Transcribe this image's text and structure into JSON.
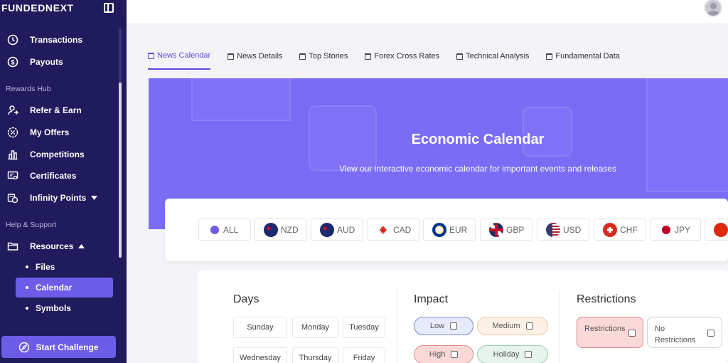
{
  "brand": {
    "logo": "FUNDEDNEXT"
  },
  "sidebar": {
    "items": [
      {
        "label": "Transactions",
        "icon": "clock-icon"
      },
      {
        "label": "Payouts",
        "icon": "dollar-icon"
      }
    ],
    "rewards_label": "Rewards Hub",
    "rewards_items": [
      {
        "label": "Refer & Earn",
        "icon": "user-share-icon"
      },
      {
        "label": "My Offers",
        "icon": "percent-badge-icon"
      },
      {
        "label": "Competitions",
        "icon": "bar-chart-icon"
      },
      {
        "label": "Certificates",
        "icon": "certificate-icon"
      },
      {
        "label": "Infinity Points",
        "icon": "coins-icon"
      }
    ],
    "help_label": "Help & Support",
    "resources_label": "Resources",
    "resources_sub": [
      {
        "label": "Files"
      },
      {
        "label": "Calendar",
        "active": true
      },
      {
        "label": "Symbols"
      }
    ],
    "start_button": "Start Challenge"
  },
  "tabs": [
    {
      "label": "News Calendar",
      "active": true
    },
    {
      "label": "News Details"
    },
    {
      "label": "Top Stories"
    },
    {
      "label": "Forex Cross Rates"
    },
    {
      "label": "Technical Analysis"
    },
    {
      "label": "Fundamental Data"
    }
  ],
  "hero": {
    "title": "Economic Calendar",
    "subtitle": "View our interactive economic calendar for important events and releases"
  },
  "currencies": [
    {
      "code": "ALL",
      "color": "#6c5ce7"
    },
    {
      "code": "NZD",
      "color": "#1a2a6c"
    },
    {
      "code": "AUD",
      "color": "#1a2a6c"
    },
    {
      "code": "CAD",
      "color": "#d52b1e"
    },
    {
      "code": "EUR",
      "color": "#003399"
    },
    {
      "code": "GBP",
      "color": "#1a2a6c"
    },
    {
      "code": "USD",
      "color": "#3c3b6e"
    },
    {
      "code": "CHF",
      "color": "#d52b1e"
    },
    {
      "code": "JPY",
      "color": "#bc002d"
    },
    {
      "code": "",
      "color": "#de2910"
    }
  ],
  "filters": {
    "days_title": "Days",
    "days": [
      "Sunday",
      "Monday",
      "Tuesday",
      "Wednesday",
      "Thursday",
      "Friday"
    ],
    "impact_title": "Impact",
    "impact": [
      {
        "label": "Low",
        "bg": "#e8ebfb",
        "border": "#7d86d6"
      },
      {
        "label": "Medium",
        "bg": "#fdf1e6",
        "border": "#f0c7a4"
      },
      {
        "label": "High",
        "bg": "#fbd9d9",
        "border": "#e08a8a"
      },
      {
        "label": "Holiday",
        "bg": "#e6f4ec",
        "border": "#9ccfb1"
      }
    ],
    "restrictions_title": "Restrictions",
    "restrictions": [
      {
        "label": "Restrictions",
        "bg": "#fbd9d9",
        "border": "#e08a8a"
      },
      {
        "label": "No\nRestrictions",
        "bg": "#ffffff",
        "border": "#cfcfd6"
      }
    ]
  }
}
